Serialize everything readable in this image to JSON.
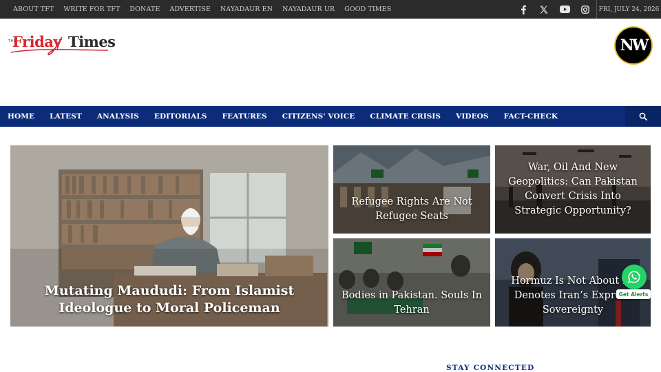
{
  "topbar": {
    "links": [
      "ABOUT TFT",
      "WRITE FOR TFT",
      "DONATE",
      "ADVERTISE",
      "NAYADAUR EN",
      "NAYADAUR UR",
      "GOOD TIMES"
    ],
    "social_icons": [
      "facebook-icon",
      "x-icon",
      "youtube-icon",
      "instagram-icon"
    ],
    "date": "FRI, JULY 24, 2026"
  },
  "header": {
    "logo": {
      "small": "THE",
      "friday": "Friday",
      "times": "Times"
    },
    "badge": "NW"
  },
  "nav": {
    "items": [
      "HOME",
      "LATEST",
      "ANALYSIS",
      "EDITORIALS",
      "FEATURES",
      "CITIZENS' VOICE",
      "CLIMATE CRISIS",
      "VIDEOS",
      "FACT-CHECK"
    ],
    "search_icon": "search-icon"
  },
  "featured": {
    "main": {
      "title": "Mutating Maududi: From Islamist Ideologue to Moral Policeman"
    },
    "stories": [
      {
        "title": "Refugee Rights Are Not Refugee Seats"
      },
      {
        "title": "War, Oil And New Geopolitics: Can Pakistan Convert Crisis Into Strategic Opportunity?"
      },
      {
        "title": "Bodies in Pakistan. Souls In Tehran"
      },
      {
        "title": "Hormuz Is Not About Fe... Denotes Iran’s Express... Sovereignty",
        "visible_lines": [
          "Hormuz Is Not About Fe",
          "Denotes Iran’s Express",
          "Sovereignty"
        ]
      }
    ]
  },
  "whatsapp": {
    "label": "Get Alerts"
  },
  "sidebar": {
    "heading": "STAY CONNECTED"
  },
  "colors": {
    "nav": "#0c2c7a",
    "topbar": "#2b2b2b",
    "brand_red": "#d6262d",
    "whatsapp": "#25d366"
  }
}
